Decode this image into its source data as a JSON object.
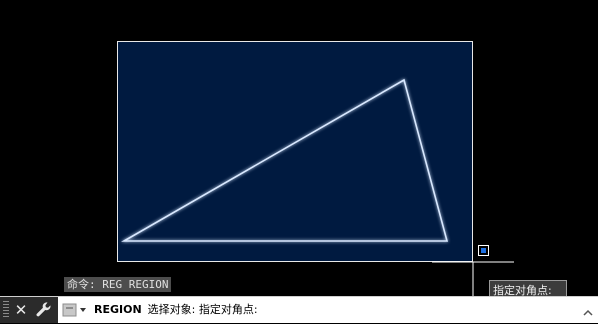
{
  "viewport": {
    "background_color": "#000000",
    "drawing_area_color": "#001a40",
    "drawing_area_border_color": "#e8e8e8",
    "triangle_color": "#d8e8ff",
    "cursor_color": "#ffffff",
    "pickbox_color": "#1e6fe0"
  },
  "command_history": {
    "line": "命令: REG REGION"
  },
  "tooltip": {
    "text": "指定对角点:"
  },
  "command_line": {
    "command_name": "REGION",
    "prompt": "选择对象: 指定对角点:",
    "close_icon": "close-icon",
    "customize_icon": "wrench-icon",
    "recent_icon": "recent-commands-icon",
    "dropdown_icon": "chevron-up-icon"
  }
}
